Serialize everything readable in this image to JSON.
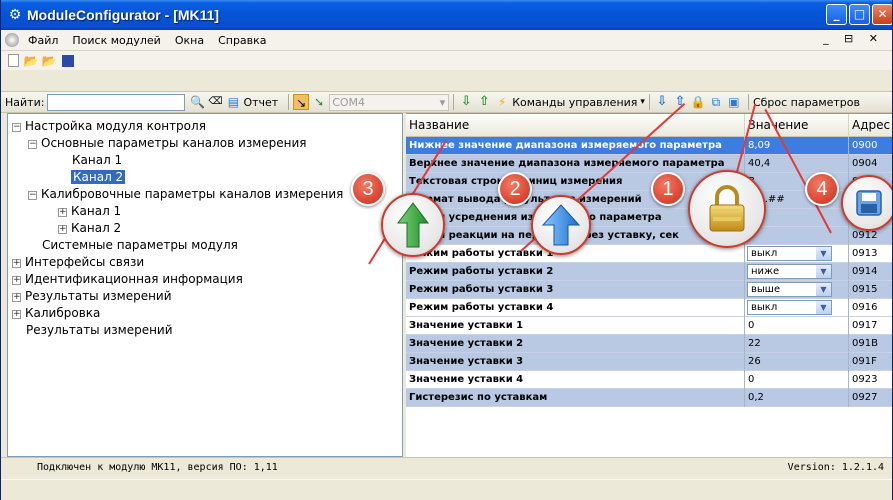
{
  "window": {
    "title": "ModuleConfigurator - [MK11]"
  },
  "menu": {
    "items": [
      "Файл",
      "Поиск модулей",
      "Окна",
      "Справка"
    ],
    "right": "_ ⊟ ✕"
  },
  "toolbar": {
    "find_label": "Найти:",
    "find_value": "",
    "report_label": "Отчет",
    "com_port": "COM4",
    "commands_label": "Команды управления",
    "reset_label": "Сброс параметров"
  },
  "tree": {
    "nodes": [
      {
        "label": "Настройка модуля контроля",
        "expander": "⊟"
      },
      {
        "label": "Основные параметры каналов измерения",
        "expander": "⊟"
      },
      {
        "label": "Канал 1",
        "expander": ""
      },
      {
        "label": "Канал 2",
        "expander": ""
      },
      {
        "label": "Калибровочные параметры каналов измерения",
        "expander": "⊟"
      },
      {
        "label": "Канал 1",
        "expander": "+"
      },
      {
        "label": "Канал 2",
        "expander": "+"
      },
      {
        "label": "Системные параметры модуля",
        "expander": ""
      },
      {
        "label": "Интерфейсы связи",
        "expander": "+"
      },
      {
        "label": "Идентификационная информация",
        "expander": "+"
      },
      {
        "label": "Результаты измерений",
        "expander": "+"
      },
      {
        "label": "Калибровка",
        "expander": "+"
      },
      {
        "label": "Результаты измерений",
        "expander": ""
      }
    ]
  },
  "grid": {
    "headers": [
      "Название",
      "Значение",
      "Адрес"
    ],
    "rows": [
      {
        "name": "Нижнее значение диапазона измеряемого параметра",
        "value": "8,09",
        "address": "0900"
      },
      {
        "name": "Верхнее значение диапазона измеряемого параметра",
        "value": "40,4",
        "address": "0904"
      },
      {
        "name": "Текстовая строка единиц измерения",
        "value": "В",
        "address": "0908"
      },
      {
        "name": "Формат вывода результатов измерений",
        "value": "##.##",
        "address": "090C"
      },
      {
        "name": "Время усреднения измеряемого параметра",
        "value": "3",
        "address": "0910"
      },
      {
        "name": "Время реакции на переход через уставку, сек",
        "value": "1",
        "address": "0912"
      },
      {
        "name": "Режим работы уставки 1",
        "value": "выкл",
        "address": "0913"
      },
      {
        "name": "Режим работы уставки 2",
        "value": "ниже",
        "address": "0914"
      },
      {
        "name": "Режим работы уставки 3",
        "value": "выше",
        "address": "0915"
      },
      {
        "name": "Режим работы уставки 4",
        "value": "выкл",
        "address": "0916"
      },
      {
        "name": "Значение уставки 1",
        "value": "0",
        "address": "0917"
      },
      {
        "name": "Значение уставки 2",
        "value": "22",
        "address": "091B"
      },
      {
        "name": "Значение уставки 3",
        "value": "26",
        "address": "091F"
      },
      {
        "name": "Значение уставки 4",
        "value": "0",
        "address": "0923"
      },
      {
        "name": "Гистерезис по уставкам",
        "value": "0,2",
        "address": "0927"
      }
    ]
  },
  "status": {
    "left": "Подключен к модулю МК11, версия ПО: 1,11",
    "right": "Version: 1.2.1.4"
  },
  "callouts": [
    "1",
    "2",
    "3",
    "4"
  ],
  "icons": {
    "lock": "lock-icon",
    "save": "save-icon",
    "upload": "arrow-up-icon",
    "download": "arrow-down-icon"
  },
  "colors": {
    "titlebar": "#0553d7",
    "row_alt": "#b9c9e3",
    "row_highlight": "#3d7ce1",
    "callout": "#e03a3a"
  }
}
